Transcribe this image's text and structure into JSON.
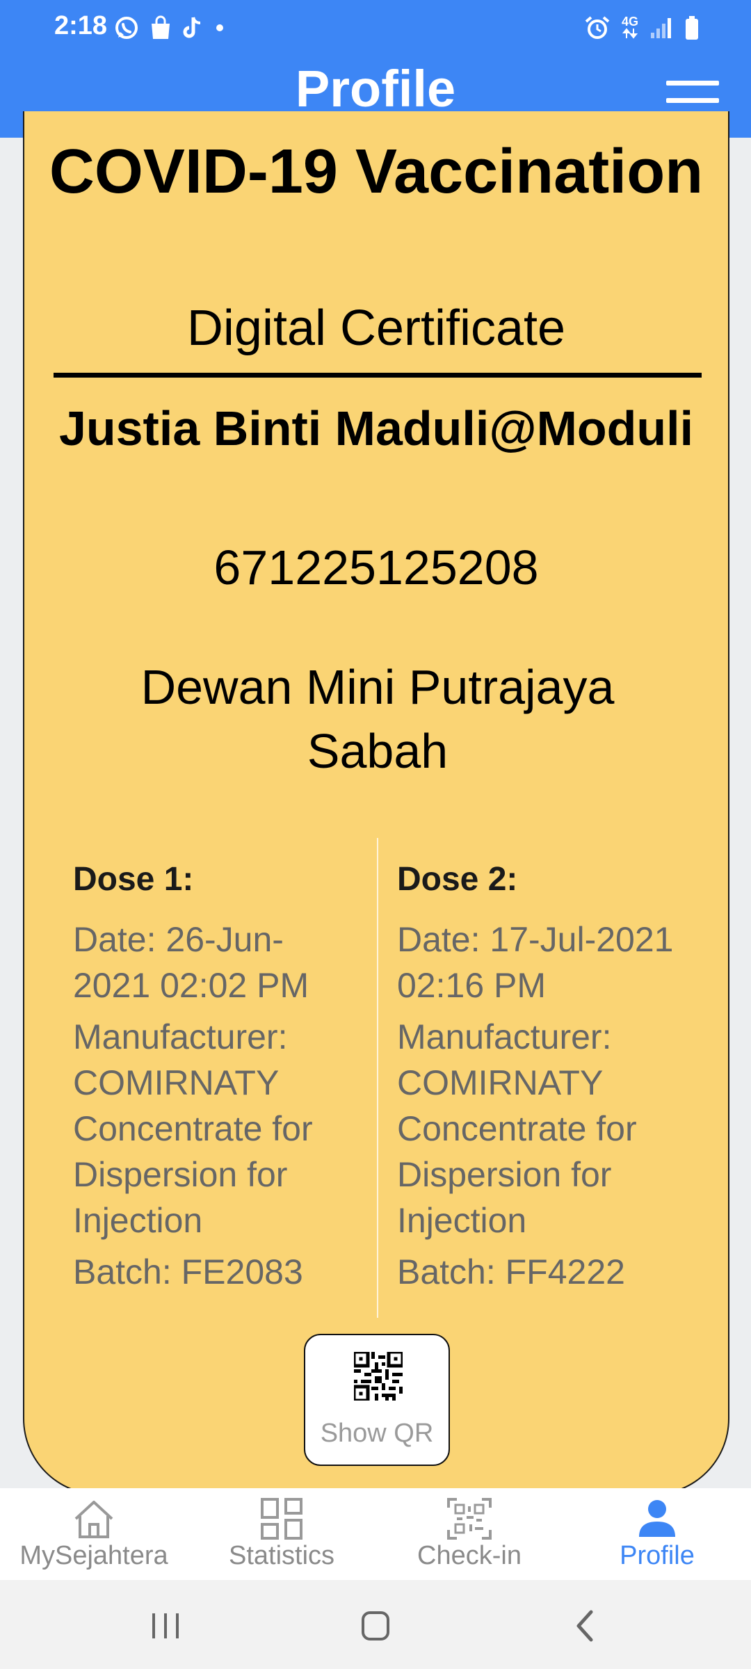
{
  "status_bar": {
    "time": "2:18",
    "network": "4G"
  },
  "header": {
    "title": "Profile"
  },
  "certificate": {
    "title": "COVID-19 Vaccination",
    "subtitle": "Digital Certificate",
    "holder_name": "Justia Binti Maduli@Moduli",
    "holder_id": "671225125208",
    "vaccination_center": "Dewan Mini Putrajaya Sabah",
    "doses": [
      {
        "heading": "Dose 1:",
        "date": "Date: 26-Jun-2021 02:02 PM",
        "manufacturer": "Manufacturer: COMIRNATY Concentrate for Dispersion for Injection",
        "batch": "Batch: FE2083"
      },
      {
        "heading": "Dose 2:",
        "date": "Date: 17-Jul-2021 02:16 PM",
        "manufacturer": "Manufacturer: COMIRNATY Concentrate for Dispersion for Injection",
        "batch": "Batch: FF4222"
      }
    ],
    "qr_button_label": "Show QR"
  },
  "bottom_nav": {
    "items": [
      {
        "label": "MySejahtera",
        "icon": "home-icon",
        "active": false
      },
      {
        "label": "Statistics",
        "icon": "grid-icon",
        "active": false
      },
      {
        "label": "Check-in",
        "icon": "qr-scan-icon",
        "active": false
      },
      {
        "label": "Profile",
        "icon": "person-icon",
        "active": true
      }
    ]
  },
  "colors": {
    "header_blue": "#3d86f5",
    "card_yellow": "#fad474",
    "active_nav": "#3d86f5",
    "inactive_nav": "#8a8a8a"
  }
}
